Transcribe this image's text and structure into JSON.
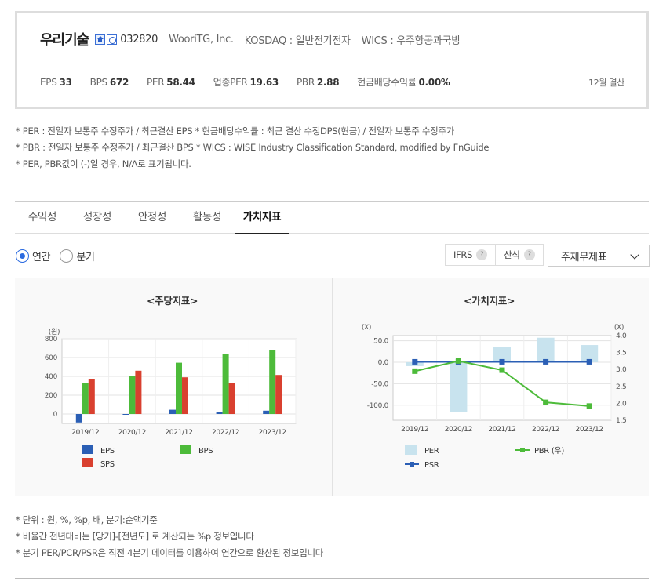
{
  "corp": {
    "name": "우리기술",
    "code": "032820",
    "english_name": "WooriTG, Inc.",
    "market": "KOSDAQ : 일반전기전자",
    "wics": "WICS : 우주항공과국방",
    "icons": [
      "home-icon",
      "building-icon"
    ],
    "stats": [
      {
        "label": "EPS",
        "value": "33"
      },
      {
        "label": "BPS",
        "value": "672"
      },
      {
        "label": "PER",
        "value": "58.44"
      },
      {
        "label": "업종PER",
        "value": "19.63"
      },
      {
        "label": "PBR",
        "value": "2.88"
      },
      {
        "label": "현금배당수익률",
        "value": "0.00%"
      }
    ],
    "settlement": "12월 결산"
  },
  "notes": [
    "* PER : 전일자 보통주 수정주가 / 최근결산 EPS * 현금배당수익률 : 최근 결산 수정DPS(현금) / 전일자 보통주 수정주가",
    "* PBR : 전일자 보통주 수정주가 / 최근결산 BPS * WICS : WISE Industry Classification Standard, modified by FnGuide",
    "* PER, PBR값이 (-)일 경우, N/A로 표기됩니다."
  ],
  "tabs": [
    "수익성",
    "성장성",
    "안정성",
    "활동성",
    "가치지표"
  ],
  "active_tab": "가치지표",
  "period": {
    "annual": "연간",
    "quarter": "분기",
    "selected": "연간"
  },
  "controls": {
    "ifrs": "IFRS",
    "calc": "산식",
    "help": "?",
    "select_value": "주재무제표"
  },
  "colors": {
    "eps": "#2b5fb5",
    "bps": "#4dbb3a",
    "sps": "#d9402f",
    "per": "#c8e3ee",
    "pbr": "#4dbb3a",
    "psr": "#2b5fb5"
  },
  "chart_data": [
    {
      "type": "bar",
      "title": "<주당지표>",
      "unit_label": "(원)",
      "categories": [
        "2019/12",
        "2020/12",
        "2021/12",
        "2022/12",
        "2023/12"
      ],
      "series": [
        {
          "name": "EPS",
          "values": [
            -90,
            -8,
            45,
            20,
            35
          ]
        },
        {
          "name": "BPS",
          "values": [
            330,
            400,
            545,
            635,
            675
          ]
        },
        {
          "name": "SPS",
          "values": [
            375,
            460,
            390,
            330,
            415
          ]
        }
      ],
      "ylim": [
        -100,
        800
      ],
      "yticks": [
        0,
        200,
        400,
        600,
        800
      ],
      "grid": true,
      "legend": "bottom"
    },
    {
      "type": "bar+line",
      "title": "<가치지표>",
      "left_unit_label": "(X)",
      "right_unit_label": "(X)",
      "categories": [
        "2019/12",
        "2020/12",
        "2021/12",
        "2022/12",
        "2023/12"
      ],
      "series": [
        {
          "name": "PER",
          "axis": "left",
          "type": "bar",
          "values": [
            -9,
            -115,
            35,
            57,
            40
          ]
        },
        {
          "name": "PBR (우)",
          "axis": "right",
          "type": "line",
          "values": [
            2.95,
            3.25,
            2.98,
            2.03,
            1.92
          ]
        },
        {
          "name": "PSR",
          "axis": "left",
          "type": "line",
          "values": [
            1,
            1,
            1,
            1,
            1
          ]
        }
      ],
      "ylim_left": [
        -135,
        62
      ],
      "yticks_left": [
        "50.0",
        "0.0",
        "-50.0",
        "-100.0"
      ],
      "ylim_right": [
        1.5,
        4.0
      ],
      "yticks_right": [
        "4.0",
        "3.5",
        "3.0",
        "2.5",
        "2.0",
        "1.5"
      ],
      "grid": true,
      "legend": "bottom"
    }
  ],
  "footer_notes": [
    "* 단위 : 원, %, %p, 배, 분기:순액기준",
    "* 비율간 전년대비는 [당기]-[전년도] 로 계산되는 %p 정보입니다",
    "* 분기 PER/PCR/PSR은 직전 4분기 데이터를 이용하여 연간으로 환산된 정보입니다"
  ]
}
